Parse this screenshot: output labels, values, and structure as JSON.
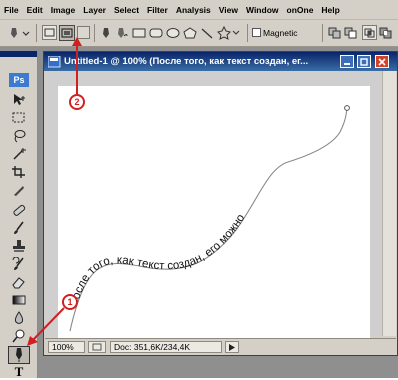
{
  "menu": [
    "File",
    "Edit",
    "Image",
    "Layer",
    "Select",
    "Filter",
    "Analysis",
    "View",
    "Window",
    "onOne",
    "Help"
  ],
  "options": {
    "magnetic_label": "Magnetic"
  },
  "tools_panel": {
    "logo": "Ps",
    "type_tool_glyph": "T"
  },
  "document": {
    "title": "Untitled-1 @ 100% (После того, как текст создан, ег...",
    "path_text": "После того, как текст создан, его можно",
    "zoom": "100%",
    "doc_info": "Doc: 351,6K/234,4K"
  },
  "callouts": [
    {
      "number": "1",
      "color": "#d21f1f"
    },
    {
      "number": "2",
      "color": "#d21f1f"
    }
  ],
  "colors": {
    "title_bar": "#0a246a",
    "accent": "#d21f1f",
    "chrome": "#d4d0c8"
  }
}
